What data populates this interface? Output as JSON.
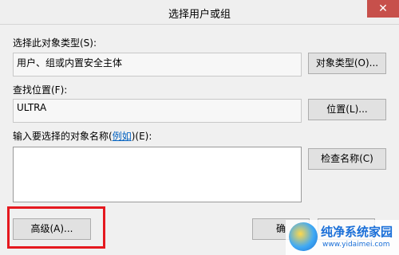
{
  "window": {
    "title": "选择用户或组",
    "close_glyph": "✕"
  },
  "object_type": {
    "label": "选择此对象类型(S):",
    "value": "用户、组或内置安全主体",
    "button": "对象类型(O)..."
  },
  "location": {
    "label": "查找位置(F):",
    "value": "ULTRA",
    "button": "位置(L)..."
  },
  "object_names": {
    "label_prefix": "输入要选择的对象名称(",
    "label_link": "例如",
    "label_suffix": ")(E):",
    "value": "",
    "check_button": "检查名称(C)"
  },
  "footer": {
    "advanced_button": "高级(A)...",
    "ok_button_partial": "确"
  },
  "watermark": {
    "name": "纯净系统家园",
    "url": "www.yidaimei.com"
  },
  "colors": {
    "highlight_frame": "#e5191f",
    "close_button": "#c7504b",
    "link": "#0563c1"
  }
}
